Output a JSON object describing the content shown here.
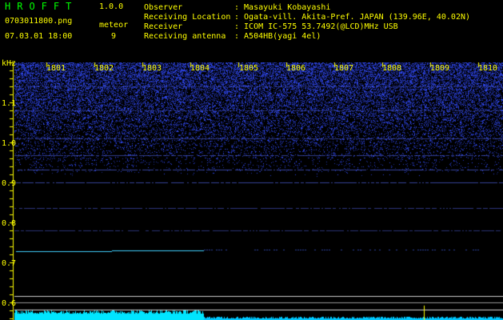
{
  "app": {
    "name": "HROFFT",
    "version": "1.0.0"
  },
  "file": {
    "name": "0703011800.png",
    "datetime": "07.03.01 18:00"
  },
  "meteor": {
    "label": "meteor",
    "count": "9"
  },
  "info": [
    {
      "key": "Observer",
      "value": ": Masayuki Kobayashi"
    },
    {
      "key": "Receiving Location",
      "value": ": Ogata-vill. Akita-Pref. JAPAN (139.96E, 40.02N)"
    },
    {
      "key": "Receiver",
      "value": ": ICOM IC-575 53.7492(@LCD)MHz USB"
    },
    {
      "key": "Receiving antenna",
      "value": ": A504HB(yagi 4el)"
    }
  ],
  "time_axis": [
    "1801",
    "1802",
    "1803",
    "1804",
    "1805",
    "1806",
    "1807",
    "1808",
    "1809",
    "1810"
  ],
  "freq_axis": {
    "unit": "kHz",
    "labels": [
      "1.1",
      "1.0",
      "0.9",
      "0.8",
      "0.7",
      "0.6"
    ]
  },
  "colors": {
    "text": "#ffff00",
    "title": "#00ff00",
    "background": "#000000",
    "noise": "#3344ff",
    "trace": "#33ccff"
  }
}
